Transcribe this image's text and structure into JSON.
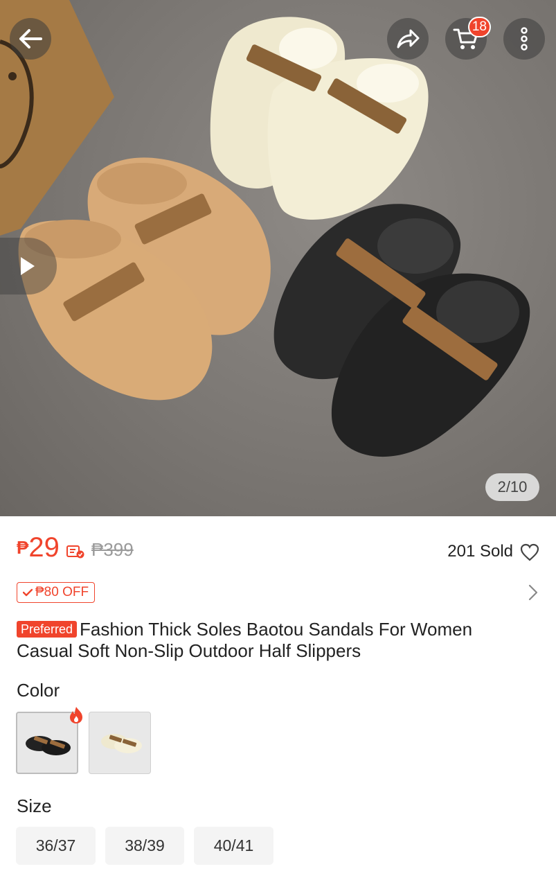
{
  "gallery": {
    "counter": "2/10",
    "cart_count": "18",
    "icons": [
      "back-arrow-icon",
      "share-icon",
      "cart-icon",
      "more-icon",
      "play-icon"
    ]
  },
  "price": {
    "currency": "₱",
    "amount": "29",
    "original": "₱399",
    "sold": "201 Sold"
  },
  "voucher": {
    "label": "₱80 OFF"
  },
  "product": {
    "badge": "Preferred",
    "title": "Fashion Thick Soles Baotou Sandals For Women Casual Soft Non-Slip Outdoor Half Slippers"
  },
  "color": {
    "label": "Color",
    "options": [
      "black",
      "cream"
    ]
  },
  "size": {
    "label": "Size",
    "options": [
      "36/37",
      "38/39",
      "40/41"
    ]
  },
  "colors": {
    "accent": "#f0442c",
    "text": "#222222",
    "muted": "#9a9a9a"
  }
}
